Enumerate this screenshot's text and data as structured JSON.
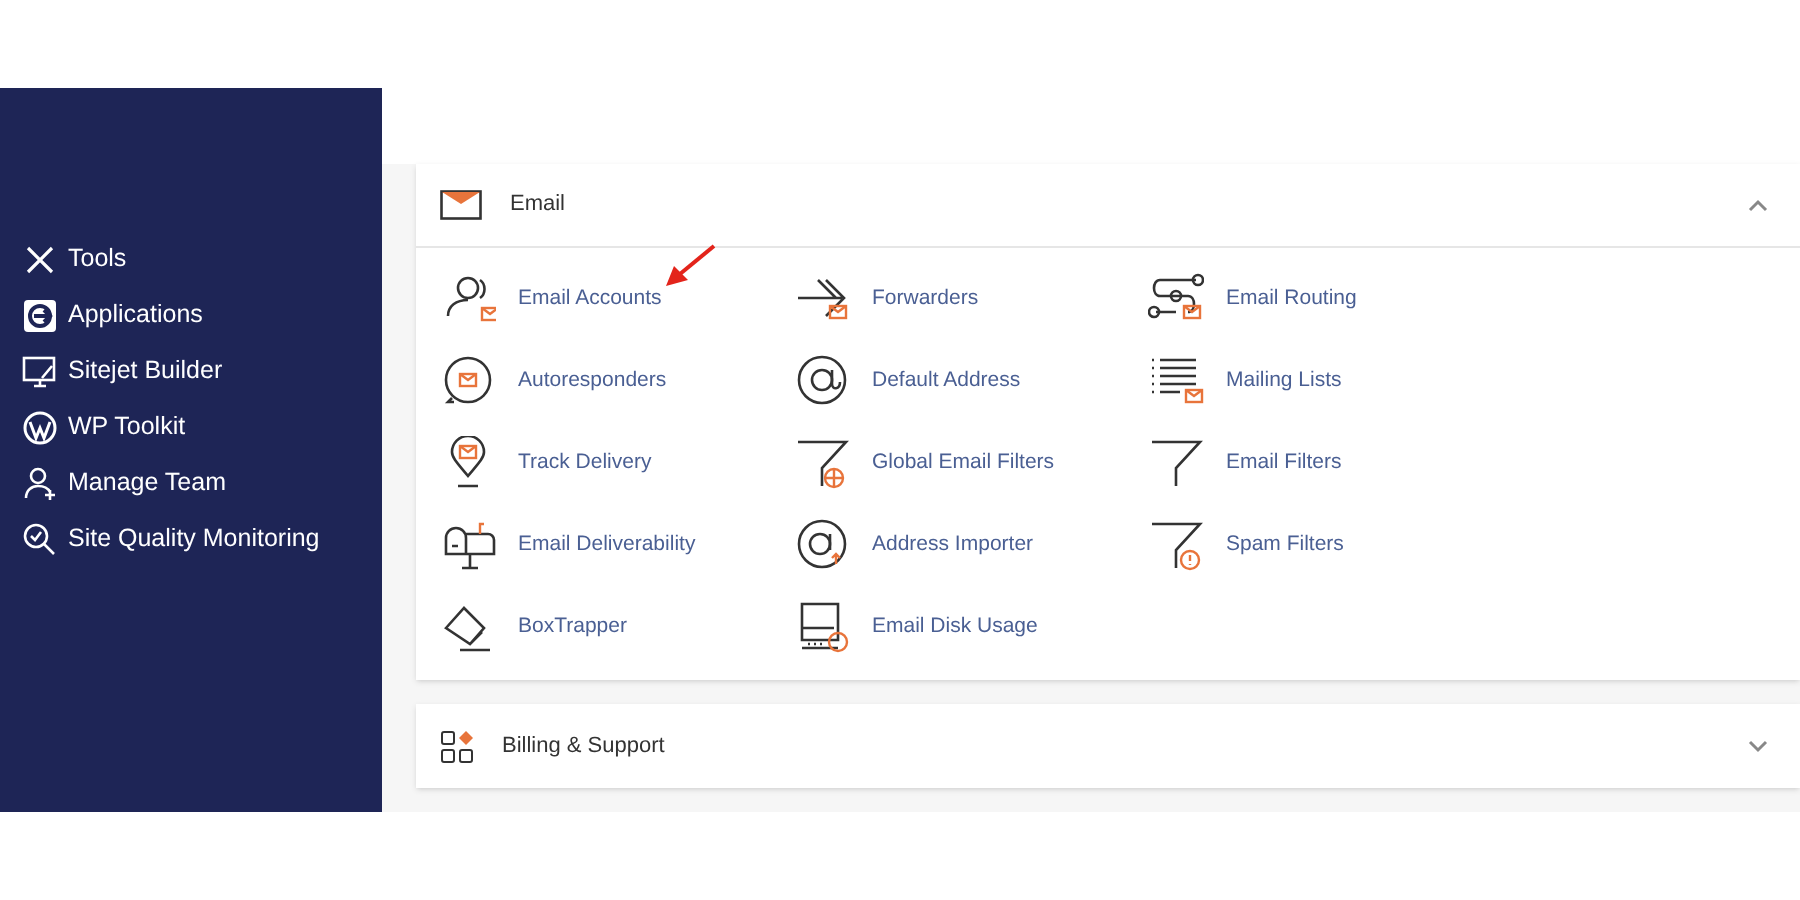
{
  "sidebar": {
    "items": [
      {
        "label": "Tools"
      },
      {
        "label": "Applications"
      },
      {
        "label": "Sitejet Builder"
      },
      {
        "label": "WP Toolkit"
      },
      {
        "label": "Manage Team"
      },
      {
        "label": "Site Quality Monitoring"
      }
    ]
  },
  "sections": [
    {
      "title": "Email",
      "expanded": true,
      "items": [
        {
          "label": "Email Accounts"
        },
        {
          "label": "Forwarders"
        },
        {
          "label": "Email Routing"
        },
        {
          "label": "Autoresponders"
        },
        {
          "label": "Default Address"
        },
        {
          "label": "Mailing Lists"
        },
        {
          "label": "Track Delivery"
        },
        {
          "label": "Global Email Filters"
        },
        {
          "label": "Email Filters"
        },
        {
          "label": "Email Deliverability"
        },
        {
          "label": "Address Importer"
        },
        {
          "label": "Spam Filters"
        },
        {
          "label": "BoxTrapper"
        },
        {
          "label": "Email Disk Usage"
        }
      ]
    },
    {
      "title": "Billing & Support",
      "expanded": false
    }
  ]
}
